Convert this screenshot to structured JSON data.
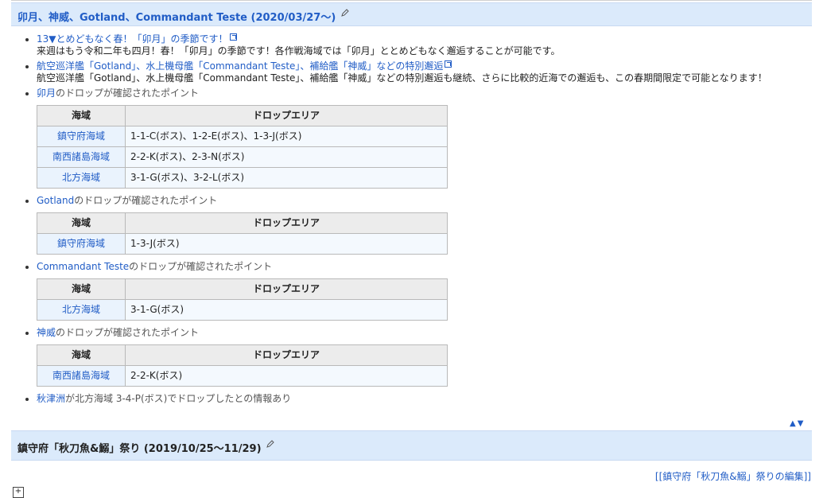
{
  "section1": {
    "title": "卯月、神威、Gotland、Commandant Teste (2020/03/27〜)"
  },
  "news": [
    {
      "link": "13▼とめどもなく春！「卯月」の季節です！",
      "desc": "来週はもう令和二年も四月！春！「卯月」の季節です！各作戦海域では「卯月」ととめどもなく邂逅することが可能です。"
    },
    {
      "link": "航空巡洋艦「Gotland」、水上機母艦「Commandant Teste」、補給艦「神威」などの特別邂逅",
      "desc": "航空巡洋艦「Gotland」、水上機母艦「Commandant Teste」、補給艦「神威」などの特別邂逅も継続、さらに比較的近海での邂逅も、この春期間限定で可能となります！"
    }
  ],
  "header": {
    "area": "海域",
    "points": "ドロップエリア"
  },
  "drops": [
    {
      "ship": "卯月",
      "suffix": "のドロップが確認されたポイント",
      "rows": [
        {
          "area": "鎮守府海域",
          "points": "1-1-C(ボス)、1-2-E(ボス)、1-3-J(ボス)"
        },
        {
          "area": "南西諸島海域",
          "points": "2-2-K(ボス)、2-3-N(ボス)"
        },
        {
          "area": "北方海域",
          "points": "3-1-G(ボス)、3-2-L(ボス)"
        }
      ]
    },
    {
      "ship": "Gotland",
      "suffix": "のドロップが確認されたポイント",
      "rows": [
        {
          "area": "鎮守府海域",
          "points": "1-3-J(ボス)"
        }
      ]
    },
    {
      "ship": "Commandant Teste",
      "suffix": "のドロップが確認されたポイント",
      "rows": [
        {
          "area": "北方海域",
          "points": "3-1-G(ボス)"
        }
      ]
    },
    {
      "ship": "神威",
      "suffix": "のドロップが確認されたポイント",
      "rows": [
        {
          "area": "南西諸島海域",
          "points": "2-2-K(ボス)"
        }
      ]
    }
  ],
  "akitsushima": {
    "ship": "秋津洲",
    "text": "が北方海域 3-4-P(ボス)でドロップしたとの情報あり"
  },
  "nav_arrows": "▲▼",
  "section2": {
    "title": "鎮守府「秋刀魚&鰯」祭り (2019/10/25〜11/29)",
    "edit_link": "[[鎮守府「秋刀魚&鰯」祭りの編集]]"
  },
  "colors": {
    "link": "#215dc6",
    "heading_bg": "#dbeafb"
  }
}
